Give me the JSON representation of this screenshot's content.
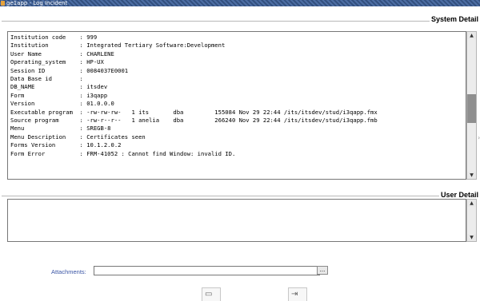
{
  "window": {
    "title": "ge1app - Log Incident"
  },
  "system_detail": {
    "heading": "System Detail",
    "lines": [
      "Institution code    : 999",
      "Institution         : Integrated Tertiary Software:Development",
      "User Name           : CHARLENE",
      "Operating_system    : HP-UX",
      "Session ID          : 0084037E0001",
      "Data Base id        :",
      "DB_NAME             : itsdev",
      "Form                : i3qapp",
      "Version             : 01.0.0.0",
      "Executable program  : -rw-rw-rw-   1 its       dba         155084 Nov 29 22:44 /its/itsdev/stud/i3qapp.fmx",
      "Source program      : -rw-r--r--   1 anelia    dba         266240 Nov 29 22:44 /its/itsdev/stud/i3qapp.fmb",
      "Menu                : SREGB-8",
      "Menu Description    : Certificates seen",
      "Forms Version       : 10.1.2.0.2",
      "Form Error          : FRM-41052 : Cannot find Window: invalid ID."
    ]
  },
  "user_detail": {
    "heading": "User Detail",
    "value": ""
  },
  "attachments": {
    "label": "Attachments:",
    "value": "",
    "browse_label": "..."
  },
  "icons": {
    "title_icon": "app-icon",
    "print": "print-icon",
    "exit": "exit-icon"
  }
}
